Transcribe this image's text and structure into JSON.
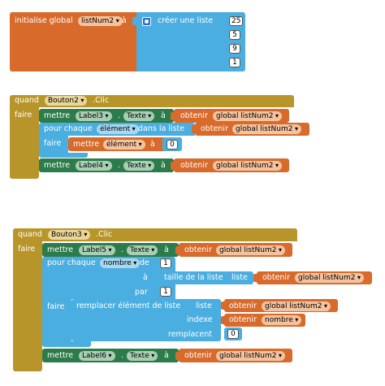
{
  "block1": {
    "initialise": "initialise global",
    "var_name": "listNum2",
    "to": "à",
    "create_list": "créer une liste",
    "items": [
      "25",
      "5",
      "9",
      "1"
    ]
  },
  "block2": {
    "when": "quand",
    "button": "Bouton2",
    "event": ".Clic",
    "do": "faire",
    "set": "mettre",
    "label_a": "Label3",
    "dot": ".",
    "prop": "Texte",
    "to": "à",
    "get": "obtenir",
    "get_var": "global listNum2",
    "for_each": "pour chaque",
    "item_var": "élément",
    "in_list": "dans la liste",
    "loop_do": "faire",
    "inner_set": "mettre",
    "inner_var": "élément",
    "inner_to": "à",
    "inner_value": "0",
    "label_b": "Label4"
  },
  "block3": {
    "when": "quand",
    "button": "Bouton3",
    "event": ".Clic",
    "do": "faire",
    "set": "mettre",
    "label_a": "Label5",
    "dot": ".",
    "prop": "Texte",
    "to": "à",
    "get": "obtenir",
    "get_var": "global listNum2",
    "for_each": "pour chaque",
    "num_var": "nombre",
    "from": "de",
    "from_value": "1",
    "to_label": "à",
    "list_length": "taille de la liste",
    "list_label": "liste",
    "by": "par",
    "by_value": "1",
    "loop_do": "faire",
    "replace": "remplacer élément de liste",
    "replace_list": "liste",
    "index": "indexe",
    "replacement": "remplacent",
    "replacement_value": "0",
    "get_number": "nombre",
    "label_b": "Label6"
  }
}
